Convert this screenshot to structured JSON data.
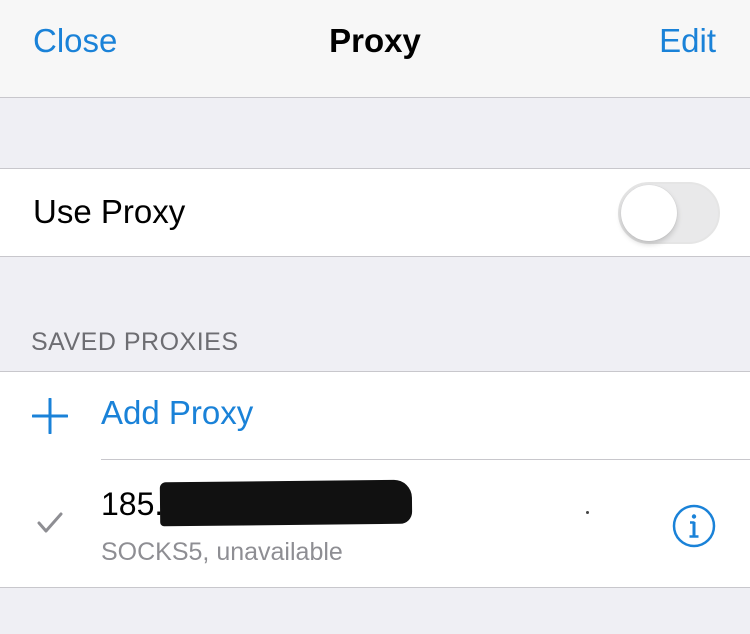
{
  "navbar": {
    "left_label": "Close",
    "title": "Proxy",
    "right_label": "Edit"
  },
  "use_proxy": {
    "label": "Use Proxy",
    "enabled": false
  },
  "saved_proxies": {
    "header": "SAVED PROXIES",
    "add_label": "Add Proxy",
    "items": [
      {
        "address": "185.6",
        "status": "SOCKS5, unavailable",
        "selected": true
      }
    ]
  },
  "colors": {
    "accent": "#1a82d8",
    "background": "#efeff4",
    "separator": "#c8c7cc",
    "secondary_text": "#8e8e93",
    "section_header": "#6d6d72"
  },
  "icons": {
    "add": "plus-icon",
    "selected": "checkmark-icon",
    "details": "info-icon"
  }
}
